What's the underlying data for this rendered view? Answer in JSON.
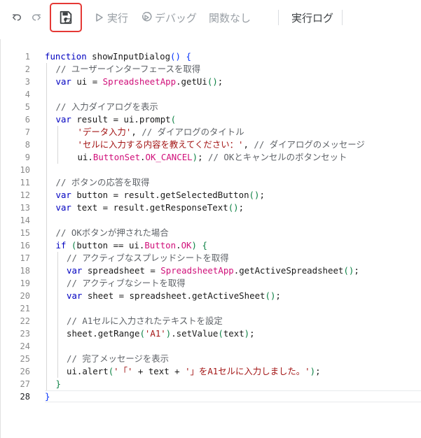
{
  "toolbar": {
    "undo_icon": "undo-icon",
    "redo_icon": "redo-icon",
    "save_icon": "save-drive-icon",
    "run_label": "実行",
    "debug_label": "デバッグ",
    "function_label": "関数なし",
    "log_label": "実行ログ",
    "highlight_color": "#e53935"
  },
  "editor": {
    "current_line": 28,
    "lines": [
      {
        "n": "1",
        "indent": 0,
        "tokens": [
          [
            "kw",
            "function"
          ],
          [
            "p",
            " showInputDialog"
          ],
          [
            "brk2",
            "()"
          ],
          [
            "p",
            " "
          ],
          [
            "brk2",
            "{"
          ]
        ]
      },
      {
        "n": "2",
        "indent": 1,
        "tokens": [
          [
            "cm",
            "// ユーザーインターフェースを取得"
          ]
        ]
      },
      {
        "n": "3",
        "indent": 1,
        "tokens": [
          [
            "kw",
            "var"
          ],
          [
            "p",
            " ui = "
          ],
          [
            "cls",
            "SpreadsheetApp"
          ],
          [
            "p",
            ".getUi"
          ],
          [
            "brk",
            "()"
          ],
          [
            "p",
            ";"
          ]
        ]
      },
      {
        "n": "4",
        "indent": 0,
        "tokens": []
      },
      {
        "n": "5",
        "indent": 1,
        "tokens": [
          [
            "cm",
            "// 入力ダイアログを表示"
          ]
        ]
      },
      {
        "n": "6",
        "indent": 1,
        "tokens": [
          [
            "kw",
            "var"
          ],
          [
            "p",
            " result = ui.prompt"
          ],
          [
            "brk",
            "("
          ]
        ]
      },
      {
        "n": "7",
        "indent": 3,
        "tokens": [
          [
            "str",
            "'データ入力'"
          ],
          [
            "p",
            ", "
          ],
          [
            "cm",
            "// ダイアログのタイトル"
          ]
        ]
      },
      {
        "n": "8",
        "indent": 3,
        "tokens": [
          [
            "str",
            "'セルに入力する内容を教えてください：'"
          ],
          [
            "p",
            ", "
          ],
          [
            "cm",
            "// ダイアログのメッセージ"
          ]
        ]
      },
      {
        "n": "9",
        "indent": 3,
        "tokens": [
          [
            "p",
            "ui."
          ],
          [
            "prop",
            "ButtonSet"
          ],
          [
            "p",
            "."
          ],
          [
            "prop",
            "OK_CANCEL"
          ],
          [
            "brk",
            ")"
          ],
          [
            "p",
            "; "
          ],
          [
            "cm",
            "// OKとキャンセルのボタンセット"
          ]
        ]
      },
      {
        "n": "10",
        "indent": 0,
        "tokens": []
      },
      {
        "n": "11",
        "indent": 1,
        "tokens": [
          [
            "cm",
            "// ボタンの応答を取得"
          ]
        ]
      },
      {
        "n": "12",
        "indent": 1,
        "tokens": [
          [
            "kw",
            "var"
          ],
          [
            "p",
            " button = result.getSelectedButton"
          ],
          [
            "brk",
            "()"
          ],
          [
            "p",
            ";"
          ]
        ]
      },
      {
        "n": "13",
        "indent": 1,
        "tokens": [
          [
            "kw",
            "var"
          ],
          [
            "p",
            " text = result.getResponseText"
          ],
          [
            "brk",
            "()"
          ],
          [
            "p",
            ";"
          ]
        ]
      },
      {
        "n": "14",
        "indent": 0,
        "tokens": []
      },
      {
        "n": "15",
        "indent": 1,
        "tokens": [
          [
            "cm",
            "// OKボタンが押された場合"
          ]
        ]
      },
      {
        "n": "16",
        "indent": 1,
        "tokens": [
          [
            "kw",
            "if"
          ],
          [
            "p",
            " "
          ],
          [
            "brk",
            "("
          ],
          [
            "p",
            "button == ui."
          ],
          [
            "prop",
            "Button"
          ],
          [
            "p",
            "."
          ],
          [
            "prop",
            "OK"
          ],
          [
            "brk",
            ")"
          ],
          [
            "p",
            " "
          ],
          [
            "brk",
            "{"
          ]
        ]
      },
      {
        "n": "17",
        "indent": 2,
        "tokens": [
          [
            "cm",
            "// アクティブなスプレッドシートを取得"
          ]
        ]
      },
      {
        "n": "18",
        "indent": 2,
        "tokens": [
          [
            "kw",
            "var"
          ],
          [
            "p",
            " spreadsheet = "
          ],
          [
            "cls",
            "SpreadsheetApp"
          ],
          [
            "p",
            ".getActiveSpreadsheet"
          ],
          [
            "brk",
            "()"
          ],
          [
            "p",
            ";"
          ]
        ]
      },
      {
        "n": "19",
        "indent": 2,
        "tokens": [
          [
            "cm",
            "// アクティブなシートを取得"
          ]
        ]
      },
      {
        "n": "20",
        "indent": 2,
        "tokens": [
          [
            "kw",
            "var"
          ],
          [
            "p",
            " sheet = spreadsheet.getActiveSheet"
          ],
          [
            "brk",
            "()"
          ],
          [
            "p",
            ";"
          ]
        ]
      },
      {
        "n": "21",
        "indent": 0,
        "tokens": []
      },
      {
        "n": "22",
        "indent": 2,
        "tokens": [
          [
            "cm",
            "// A1セルに入力されたテキストを設定"
          ]
        ]
      },
      {
        "n": "23",
        "indent": 2,
        "tokens": [
          [
            "p",
            "sheet.getRange"
          ],
          [
            "brk",
            "("
          ],
          [
            "str",
            "'A1'"
          ],
          [
            "brk",
            ")"
          ],
          [
            "p",
            ".setValue"
          ],
          [
            "brk",
            "("
          ],
          [
            "p",
            "text"
          ],
          [
            "brk",
            ")"
          ],
          [
            "p",
            ";"
          ]
        ]
      },
      {
        "n": "24",
        "indent": 0,
        "tokens": []
      },
      {
        "n": "25",
        "indent": 2,
        "tokens": [
          [
            "cm",
            "// 完了メッセージを表示"
          ]
        ]
      },
      {
        "n": "26",
        "indent": 2,
        "tokens": [
          [
            "p",
            "ui.alert"
          ],
          [
            "brk",
            "("
          ],
          [
            "str",
            "'「'"
          ],
          [
            "p",
            " + text + "
          ],
          [
            "str",
            "'」をA1セルに入力しました。'"
          ],
          [
            "brk",
            ")"
          ],
          [
            "p",
            ";"
          ]
        ]
      },
      {
        "n": "27",
        "indent": 1,
        "tokens": [
          [
            "brk",
            "}"
          ]
        ]
      },
      {
        "n": "28",
        "indent": 0,
        "tokens": [
          [
            "brk2",
            "}"
          ]
        ]
      }
    ]
  }
}
